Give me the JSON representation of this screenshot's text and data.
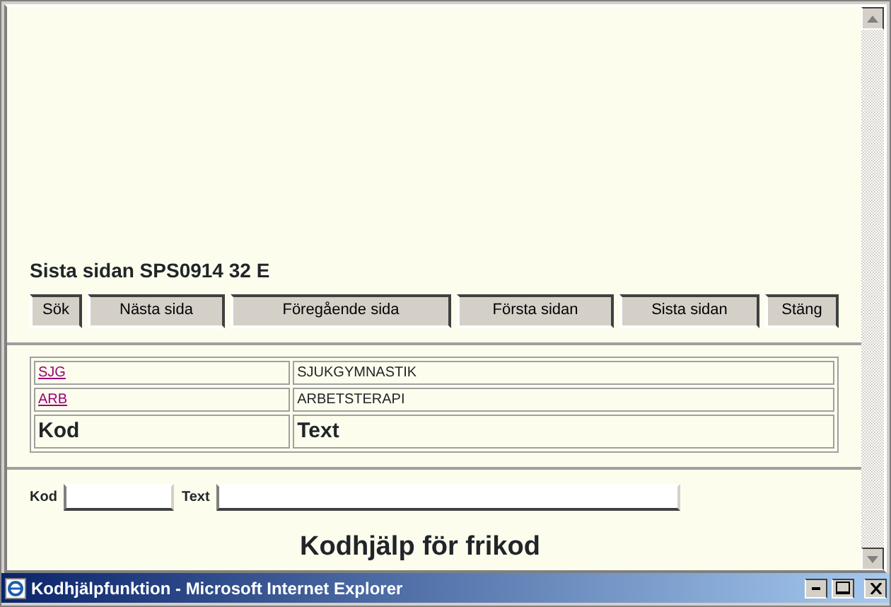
{
  "page_info": "Sista sidan SPS0914 32 E",
  "buttons": [
    "Sök",
    "Nästa sida",
    "Föregående sida",
    "Första sidan",
    "Sista sidan",
    "Stäng"
  ],
  "table": {
    "rows": [
      {
        "code": "SJG",
        "text": "SJUKGYMNASTIK"
      },
      {
        "code": "ARB",
        "text": "ARBETSTERAPI"
      }
    ],
    "columns": [
      "Kod",
      "Text"
    ]
  },
  "search_fields": [
    {
      "label": "Kod"
    },
    {
      "label": "Text"
    }
  ],
  "heading": "Kodhjälp för frikod",
  "window": {
    "title": "Kodhjälpfunktion - Microsoft Internet Explorer"
  }
}
